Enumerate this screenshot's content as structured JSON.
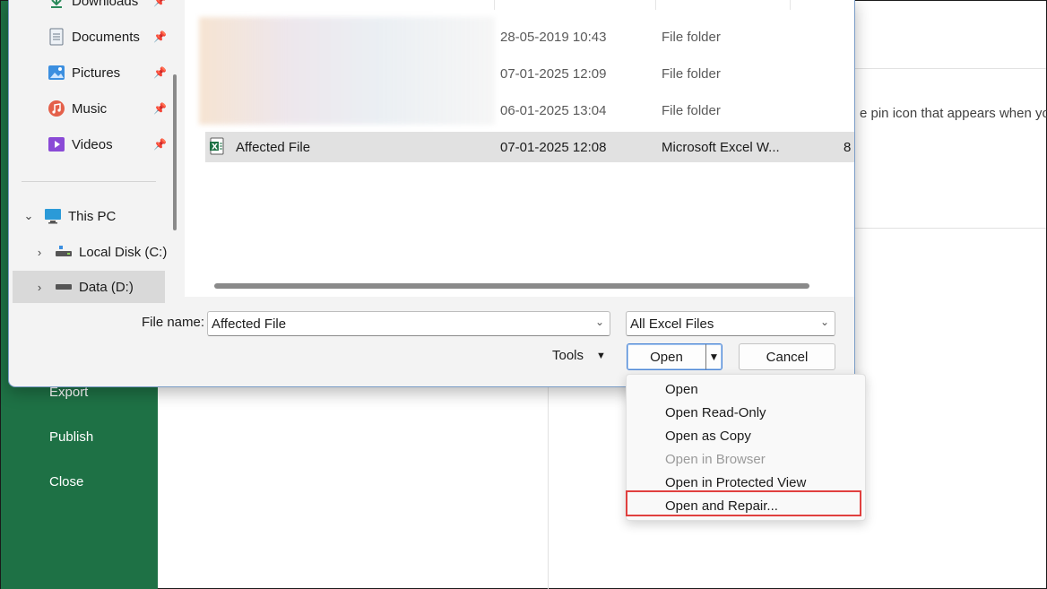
{
  "backstage": {
    "nav": [
      "Export",
      "Publish",
      "Close"
    ],
    "hint_text": "e pin icon that appears when you"
  },
  "colors": {
    "backstage_green": "#1e7145",
    "highlight_red": "#e0403f",
    "accent_blue": "#4f88d6"
  },
  "nav_pane": {
    "quick_access": [
      {
        "label": "Downloads",
        "icon": "download-icon",
        "pinned": true
      },
      {
        "label": "Documents",
        "icon": "documents-icon",
        "pinned": true
      },
      {
        "label": "Pictures",
        "icon": "pictures-icon",
        "pinned": true
      },
      {
        "label": "Music",
        "icon": "music-icon",
        "pinned": true
      },
      {
        "label": "Videos",
        "icon": "videos-icon",
        "pinned": true
      }
    ],
    "this_pc": "This PC",
    "drives": [
      {
        "label": "Local Disk (C:)",
        "icon": "drive-icon"
      },
      {
        "label": "Data (D:)",
        "icon": "drive-icon"
      }
    ]
  },
  "file_list": {
    "rows": [
      {
        "name": "",
        "date": "28-05-2019 10:43",
        "type": "File folder",
        "size": ""
      },
      {
        "name": "",
        "date": "07-01-2025 12:09",
        "type": "File folder",
        "size": ""
      },
      {
        "name": "",
        "date": "06-01-2025 13:04",
        "type": "File folder",
        "size": ""
      },
      {
        "name": "Affected File",
        "date": "07-01-2025 12:08",
        "type": "Microsoft Excel W...",
        "size": "8"
      }
    ]
  },
  "bottom_bar": {
    "file_name_label": "File name:",
    "file_name_value": "Affected File",
    "file_type_value": "All Excel Files",
    "tools_label": "Tools",
    "open_label": "Open",
    "cancel_label": "Cancel"
  },
  "open_menu": {
    "items": [
      {
        "label": "Open",
        "enabled": true
      },
      {
        "label": "Open Read-Only",
        "enabled": true
      },
      {
        "label": "Open as Copy",
        "enabled": true
      },
      {
        "label": "Open in Browser",
        "enabled": false
      },
      {
        "label": "Open in Protected View",
        "enabled": true
      },
      {
        "label": "Open and Repair...",
        "enabled": true
      }
    ]
  }
}
